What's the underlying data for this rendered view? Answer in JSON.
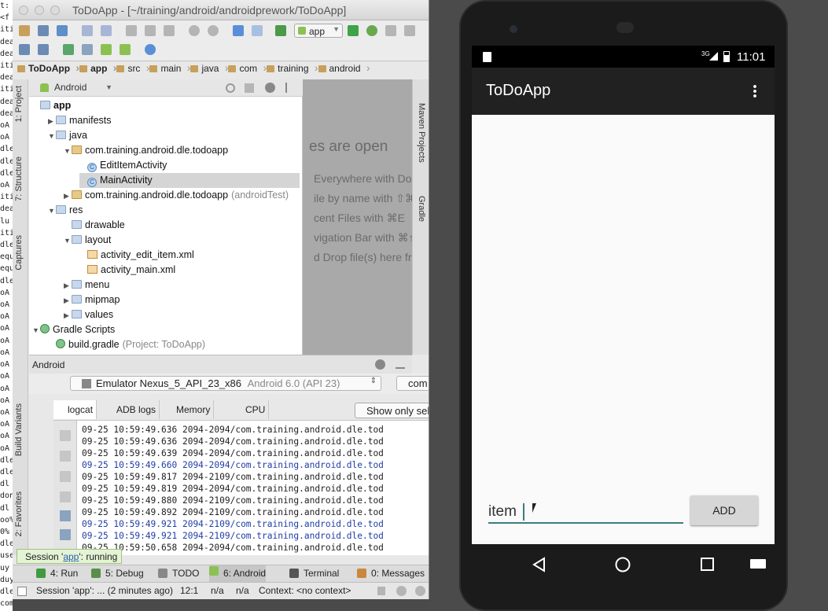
{
  "terminal": {
    "lines": [
      "t:",
      "<f",
      "iti",
      "dea",
      "dea",
      "iti",
      "dea",
      "iti",
      "dea",
      "dea",
      "oA",
      "oA",
      "dle",
      "dle",
      "dle",
      "oA",
      "iti",
      "dea",
      "lu",
      "iti",
      "dle",
      "equ",
      "equ",
      "dle",
      "oA",
      "oA",
      "oA",
      "oA",
      "oA",
      "oA",
      "oA",
      "oA",
      "oA",
      "oA",
      "oA",
      "oA",
      "oA",
      "oA",
      "dle",
      "dle",
      "dl",
      "don",
      "dl",
      "oo%",
      "0%",
      "dle",
      "use",
      "uy",
      "duy",
      "dle",
      "com",
      "omm"
    ]
  },
  "ide": {
    "title": "ToDoApp - [~/training/android/androidprework/ToDoApp]",
    "run_config": "app",
    "breadcrumbs": [
      "ToDoApp",
      "app",
      "src",
      "main",
      "java",
      "com",
      "training",
      "android"
    ],
    "left_tabs": [
      "1: Project",
      "7: Structure",
      "Captures",
      "Build Variants",
      "2: Favorites"
    ],
    "right_tabs": [
      "Maven Projects",
      "Gradle"
    ],
    "project_view": "Android",
    "tree": [
      {
        "label": "app",
        "indent": 0,
        "icon": "folder-icon",
        "arrow": ""
      },
      {
        "label": "manifests",
        "indent": 1,
        "icon": "folder-icon",
        "arrow": "▶"
      },
      {
        "label": "java",
        "indent": 1,
        "icon": "folder-icon",
        "arrow": "▼"
      },
      {
        "label": "com.training.android.dle.todoapp",
        "indent": 2,
        "icon": "package-icon",
        "arrow": "▼"
      },
      {
        "label": "EditItemActivity",
        "indent": 3,
        "icon": "class-icon",
        "arrow": ""
      },
      {
        "label": "MainActivity",
        "indent": 3,
        "icon": "class-icon",
        "arrow": "",
        "selected": true
      },
      {
        "label": "com.training.android.dle.todoapp",
        "suffix": "(androidTest)",
        "indent": 2,
        "icon": "package-icon",
        "arrow": "▶"
      },
      {
        "label": "res",
        "indent": 1,
        "icon": "folder-icon",
        "arrow": "▼"
      },
      {
        "label": "drawable",
        "indent": 2,
        "icon": "folder-icon",
        "arrow": ""
      },
      {
        "label": "layout",
        "indent": 2,
        "icon": "folder-icon",
        "arrow": "▼"
      },
      {
        "label": "activity_edit_item.xml",
        "indent": 3,
        "icon": "xml-icon",
        "arrow": ""
      },
      {
        "label": "activity_main.xml",
        "indent": 3,
        "icon": "xml-icon",
        "arrow": ""
      },
      {
        "label": "menu",
        "indent": 2,
        "icon": "folder-icon",
        "arrow": "▶"
      },
      {
        "label": "mipmap",
        "indent": 2,
        "icon": "folder-icon",
        "arrow": "▶"
      },
      {
        "label": "values",
        "indent": 2,
        "icon": "folder-icon",
        "arrow": "▶"
      },
      {
        "label": "Gradle Scripts",
        "indent": 0,
        "icon": "gradle-icon",
        "arrow": "▼"
      },
      {
        "label": "build.gradle",
        "suffix": "(Project: ToDoApp)",
        "indent": 1,
        "icon": "gradle-icon",
        "arrow": ""
      }
    ],
    "editor_hints": [
      "es are open",
      "Everywhere with Doub",
      "ile by name with ⇧⌘",
      "cent Files with ⌘E",
      "vigation Bar with ⌘↑",
      "d Drop file(s) here fro"
    ],
    "android_panel": {
      "title": "Android",
      "device": "Emulator Nexus_5_API_23_x86",
      "device_api": "Android 6.0 (API 23)",
      "process": "com",
      "tabs": [
        "logcat",
        "ADB logs",
        "Memory",
        "CPU"
      ],
      "filter_button": "Show only selecte",
      "log": [
        {
          "text": "09-25 10:59:49.636   2094-2094/com.training.android.dle.tod",
          "blue": false
        },
        {
          "text": "09-25 10:59:49.636   2094-2094/com.training.android.dle.tod",
          "blue": false
        },
        {
          "text": "09-25 10:59:49.639   2094-2094/com.training.android.dle.tod",
          "blue": false
        },
        {
          "text": "09-25 10:59:49.660   2094-2094/com.training.android.dle.tod",
          "blue": true
        },
        {
          "text": "09-25 10:59:49.817   2094-2109/com.training.android.dle.tod",
          "blue": false
        },
        {
          "text": "09-25 10:59:49.819   2094-2094/com.training.android.dle.tod",
          "blue": false
        },
        {
          "text": "09-25 10:59:49.880   2094-2109/com.training.android.dle.tod",
          "blue": false
        },
        {
          "text": "09-25 10:59:49.892   2094-2109/com.training.android.dle.tod",
          "blue": false
        },
        {
          "text": "09-25 10:59:49.921   2094-2109/com.training.android.dle.tod",
          "blue": true
        },
        {
          "text": "09-25 10:59:49.921   2094-2109/com.training.android.dle.tod",
          "blue": true
        },
        {
          "text": "09-25 10:59:50.658   2094-2094/com.training.android.dle.tod",
          "blue": false
        }
      ]
    },
    "session_tip": {
      "prefix": "Session '",
      "link": "app",
      "suffix": "': running"
    },
    "bottom_tabs": [
      {
        "label": "4: Run",
        "color": "#3f9b3f"
      },
      {
        "label": "5: Debug",
        "color": "#5a8f4a"
      },
      {
        "label": "TODO",
        "color": "#888888"
      },
      {
        "label": "6: Android",
        "color": "#8cc152",
        "selected": true
      },
      {
        "label": "Terminal",
        "color": "#555555"
      },
      {
        "label": "0: Messages",
        "color": "#c9883e"
      }
    ],
    "status": {
      "message": "Session 'app': ... (2 minutes ago)",
      "position": "12:1",
      "na1": "n/a",
      "na2": "n/a",
      "context": "Context: <no context>"
    }
  },
  "emulator": {
    "status_time": "11:01",
    "network": "3G",
    "app_title": "ToDoApp",
    "input_value": "item",
    "add_button": "ADD"
  },
  "colors": {
    "app_bar": "#212121",
    "accent": "#3c7d7d"
  }
}
